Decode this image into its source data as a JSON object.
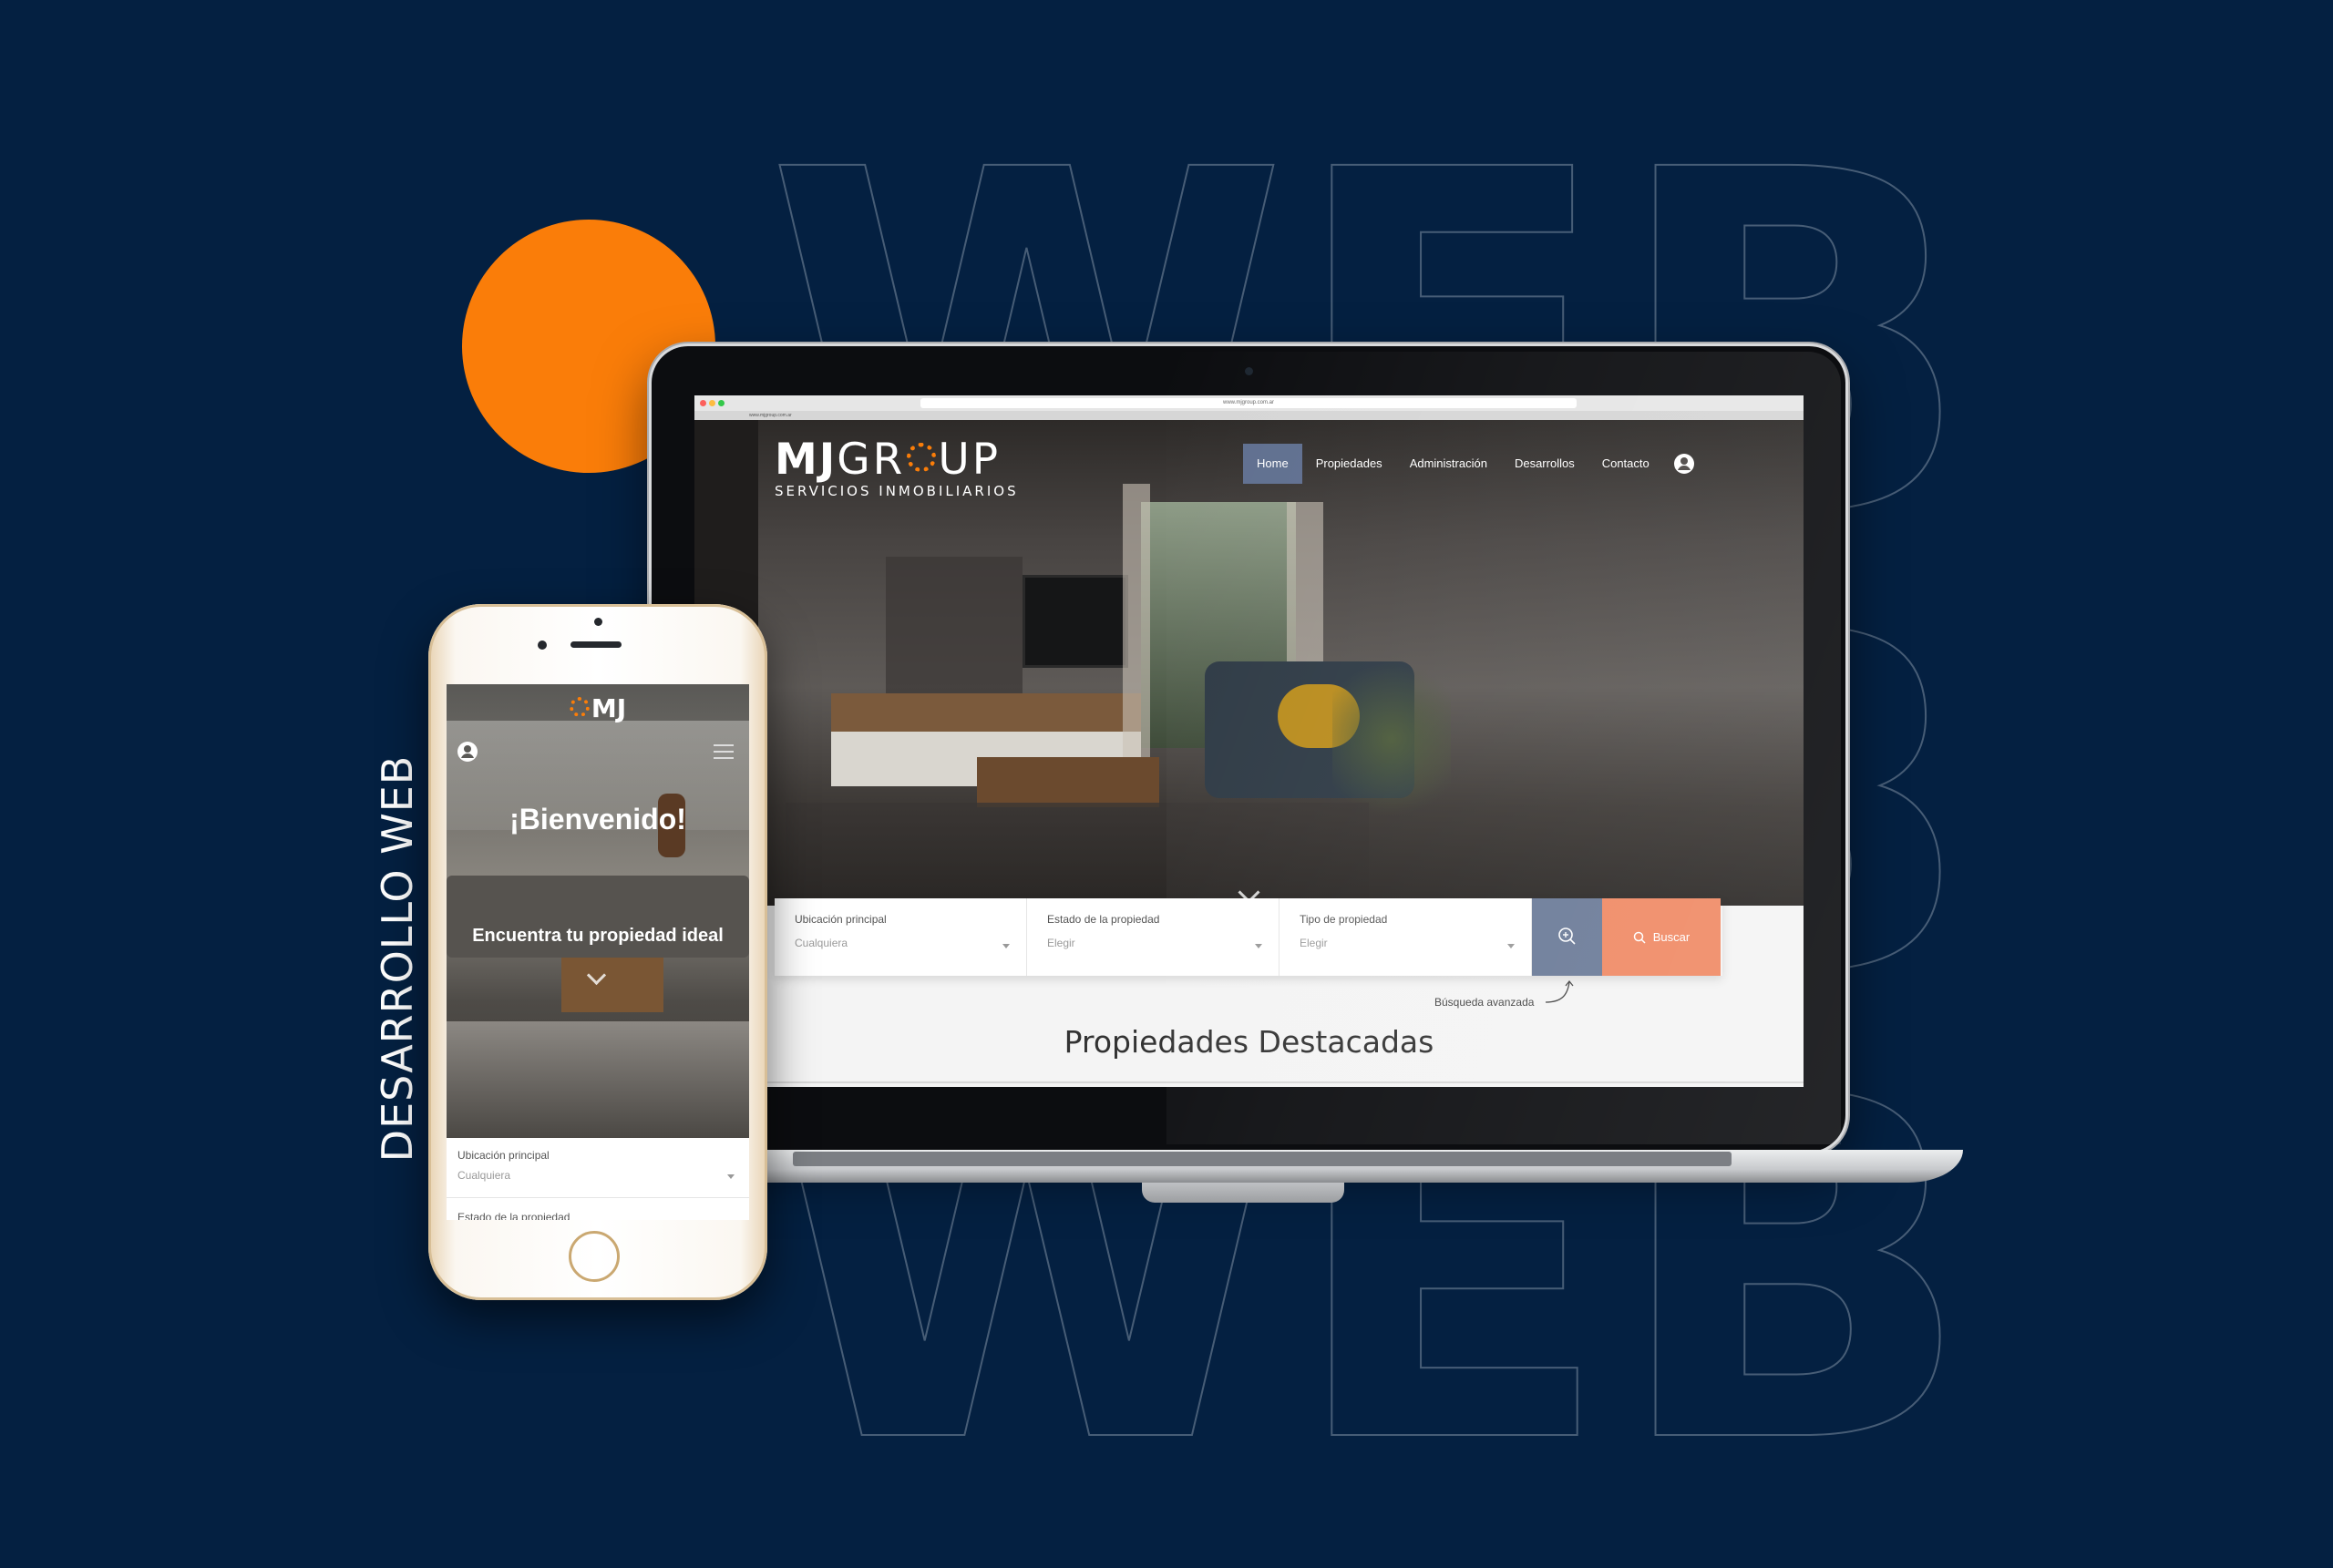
{
  "background": {
    "color": "#042041",
    "watermark_text": "WEB",
    "vertical_title": "DESARROLLO WEB",
    "accent_circle_color": "#fa7d09"
  },
  "laptop": {
    "browser": {
      "url": "www.mjgroup.com.ar",
      "tab_text": "www.mjgroup.com.ar"
    },
    "logo": {
      "part1": "MJ",
      "part2a": "GR",
      "part2b": "UP",
      "subtitle": "SERVICIOS INMOBILIARIOS"
    },
    "nav": [
      {
        "label": "Home",
        "active": true
      },
      {
        "label": "Propiedades"
      },
      {
        "label": "Administración"
      },
      {
        "label": "Desarrollos"
      },
      {
        "label": "Contacto"
      }
    ],
    "search": {
      "fields": [
        {
          "label": "Ubicación principal",
          "value": "Cualquiera"
        },
        {
          "label": "Estado de la propiedad",
          "value": "Elegir"
        },
        {
          "label": "Tipo de propiedad",
          "value": "Elegir"
        }
      ],
      "search_label": "Buscar",
      "advanced_label": "Búsqueda avanzada"
    },
    "featured_title": "Propiedades Destacadas"
  },
  "phone": {
    "logo": "MJ",
    "welcome": "¡Bienvenido!",
    "tagline": "Encuentra tu propiedad ideal",
    "field": {
      "label": "Ubicación principal",
      "value": "Cualquiera"
    },
    "field2_label": "Estado de la propiedad"
  }
}
